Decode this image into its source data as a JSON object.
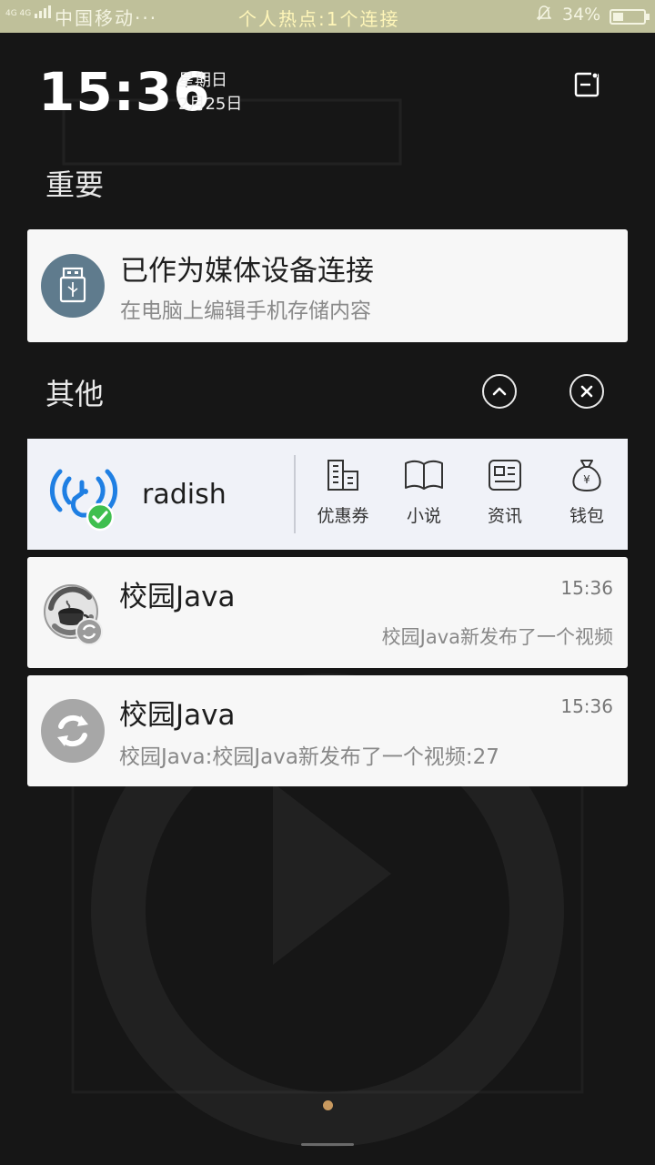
{
  "status_bar": {
    "network_type": "4G 4G",
    "carrier": "中国移动···",
    "hotspot_text": "个人热点:1个连接",
    "battery_percent": "34%",
    "battery_level": 0.34
  },
  "header": {
    "time": "15:36",
    "weekday": "星期日",
    "date": "2月25日"
  },
  "sections": {
    "important": "重要",
    "other": "其他"
  },
  "usb_notification": {
    "title": "已作为媒体设备连接",
    "subtitle": "在电脑上编辑手机存储内容"
  },
  "wifi_widget": {
    "network_name": "radish",
    "actions": [
      {
        "label": "优惠券",
        "icon": "building-icon"
      },
      {
        "label": "小说",
        "icon": "book-icon"
      },
      {
        "label": "资讯",
        "icon": "news-icon"
      },
      {
        "label": "钱包",
        "icon": "money-bag-icon"
      }
    ]
  },
  "notifications": [
    {
      "app": "校园Java",
      "time": "15:36",
      "message": "校园Java新发布了一个视频"
    },
    {
      "app": "校园Java",
      "time": "15:36",
      "message": "校园Java:校园Java新发布了一个视频:27"
    }
  ],
  "colors": {
    "status_bar_bg": "#bfc09a",
    "usb_icon_bg": "#5f7b8d",
    "wifi_blue": "#1f7fe3",
    "wifi_check_green": "#3fbf4f",
    "page_dot": "#c8995f"
  }
}
